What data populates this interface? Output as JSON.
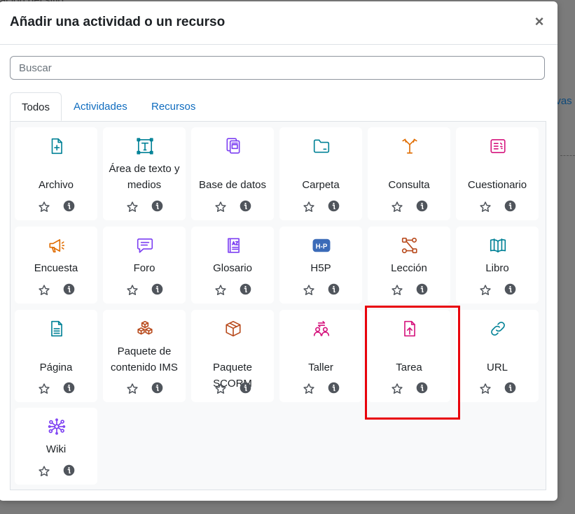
{
  "background": {
    "top_text": "ación del sitio",
    "right_text": "ivas"
  },
  "modal": {
    "title": "Añadir una actividad o un recurso",
    "close": "×",
    "search_placeholder": "Buscar",
    "tabs": [
      {
        "label": "Todos",
        "active": true
      },
      {
        "label": "Actividades",
        "active": false
      },
      {
        "label": "Recursos",
        "active": false
      }
    ],
    "items": [
      {
        "label": "Archivo",
        "icon": "file-plus-icon",
        "color": "#008196"
      },
      {
        "label": "Área de texto y medios",
        "icon": "text-field-icon",
        "color": "#008196"
      },
      {
        "label": "Base de datos",
        "icon": "database-icon",
        "color": "#7c3ff2"
      },
      {
        "label": "Carpeta",
        "icon": "folder-icon",
        "color": "#008196"
      },
      {
        "label": "Consulta",
        "icon": "choice-icon",
        "color": "#e06c00"
      },
      {
        "label": "Cuestionario",
        "icon": "quiz-icon",
        "color": "#d5147d"
      },
      {
        "label": "Encuesta",
        "icon": "megaphone-icon",
        "color": "#e06c00"
      },
      {
        "label": "Foro",
        "icon": "forum-icon",
        "color": "#7c3ff2"
      },
      {
        "label": "Glosario",
        "icon": "glossary-icon",
        "color": "#7c3ff2"
      },
      {
        "label": "H5P",
        "icon": "h5p-icon",
        "color": "#3b6bb8"
      },
      {
        "label": "Lección",
        "icon": "lesson-icon",
        "color": "#b84a1c"
      },
      {
        "label": "Libro",
        "icon": "book-icon",
        "color": "#008196"
      },
      {
        "label": "Página",
        "icon": "page-icon",
        "color": "#008196"
      },
      {
        "label": "Paquete de contenido IMS",
        "icon": "ims-package-icon",
        "color": "#b84a1c"
      },
      {
        "label": "Paquete SCORM",
        "icon": "scorm-package-icon",
        "color": "#b84a1c"
      },
      {
        "label": "Taller",
        "icon": "workshop-icon",
        "color": "#d5147d"
      },
      {
        "label": "Tarea",
        "icon": "assignment-icon",
        "color": "#d5147d"
      },
      {
        "label": "URL",
        "icon": "link-icon",
        "color": "#008196"
      },
      {
        "label": "Wiki",
        "icon": "wiki-icon",
        "color": "#7c3ff2"
      }
    ]
  },
  "highlighted_item": "Tarea",
  "colors": {
    "highlight": "#e8000b",
    "link": "#0f6cbf",
    "action_icon": "#50555c"
  }
}
